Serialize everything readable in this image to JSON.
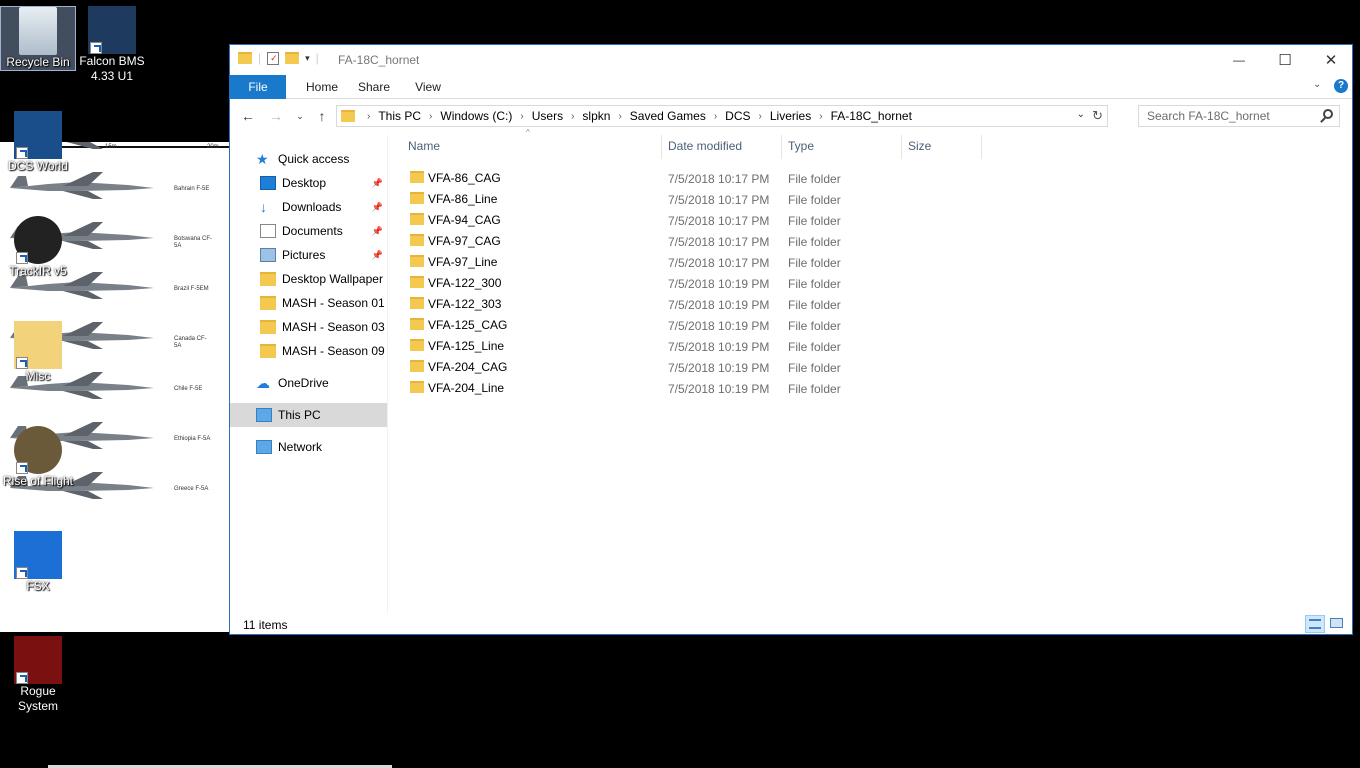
{
  "desktop": {
    "icons": [
      {
        "label": "Recycle Bin"
      },
      {
        "label": "Falcon BMS 4.33 U1"
      },
      {
        "label": "DCS World"
      },
      {
        "label": "TrackIR v5"
      },
      {
        "label": "Misc"
      },
      {
        "label": "Rise of Flight"
      },
      {
        "label": "FSX"
      },
      {
        "label": "Rogue System"
      }
    ],
    "wallpaper_labels": [
      "Austria F-5E",
      "Bahrain F-5E",
      "Botswana CF-5A",
      "Brazil F-5EM",
      "Canada CF-5A",
      "Chile F-5E",
      "Ethiopia F-5A",
      "Greece F-5A"
    ],
    "wallpaper_ticks": [
      "15m",
      "20m"
    ]
  },
  "window": {
    "title": "FA-18C_hornet",
    "controls": {
      "minimize": "—",
      "maximize": "☐",
      "close": "✕"
    },
    "ribbon_tabs": [
      "File",
      "Home",
      "Share",
      "View"
    ],
    "breadcrumb": [
      "This PC",
      "Windows (C:)",
      "Users",
      "slpkn",
      "Saved Games",
      "DCS",
      "Liveries",
      "FA-18C_hornet"
    ],
    "search_placeholder": "Search FA-18C_hornet",
    "accent_color": "#1979ca"
  },
  "nav_pane": [
    {
      "label": "Quick access",
      "icon": "star-icon"
    },
    {
      "label": "Desktop",
      "icon": "desktop-icon",
      "pinned": true
    },
    {
      "label": "Downloads",
      "icon": "download-icon",
      "pinned": true
    },
    {
      "label": "Documents",
      "icon": "document-icon",
      "pinned": true
    },
    {
      "label": "Pictures",
      "icon": "picture-icon",
      "pinned": true
    },
    {
      "label": "Desktop Wallpaper",
      "icon": "folder-icon"
    },
    {
      "label": "MASH - Season 01",
      "icon": "folder-icon"
    },
    {
      "label": "MASH - Season 03",
      "icon": "folder-icon"
    },
    {
      "label": "MASH - Season 09",
      "icon": "folder-icon"
    },
    {
      "label": "OneDrive",
      "icon": "cloud-icon"
    },
    {
      "label": "This PC",
      "icon": "computer-icon",
      "selected": true
    },
    {
      "label": "Network",
      "icon": "network-icon"
    }
  ],
  "columns": [
    "Name",
    "Date modified",
    "Type",
    "Size"
  ],
  "files": [
    {
      "name": "VFA-86_CAG",
      "date": "7/5/2018 10:17 PM",
      "type": "File folder"
    },
    {
      "name": "VFA-86_Line",
      "date": "7/5/2018 10:17 PM",
      "type": "File folder"
    },
    {
      "name": "VFA-94_CAG",
      "date": "7/5/2018 10:17 PM",
      "type": "File folder"
    },
    {
      "name": "VFA-97_CAG",
      "date": "7/5/2018 10:17 PM",
      "type": "File folder"
    },
    {
      "name": "VFA-97_Line",
      "date": "7/5/2018 10:17 PM",
      "type": "File folder"
    },
    {
      "name": "VFA-122_300",
      "date": "7/5/2018 10:19 PM",
      "type": "File folder"
    },
    {
      "name": "VFA-122_303",
      "date": "7/5/2018 10:19 PM",
      "type": "File folder"
    },
    {
      "name": "VFA-125_CAG",
      "date": "7/5/2018 10:19 PM",
      "type": "File folder"
    },
    {
      "name": "VFA-125_Line",
      "date": "7/5/2018 10:19 PM",
      "type": "File folder"
    },
    {
      "name": "VFA-204_CAG",
      "date": "7/5/2018 10:19 PM",
      "type": "File folder"
    },
    {
      "name": "VFA-204_Line",
      "date": "7/5/2018 10:19 PM",
      "type": "File folder"
    }
  ],
  "status": {
    "item_count": "11 items"
  }
}
